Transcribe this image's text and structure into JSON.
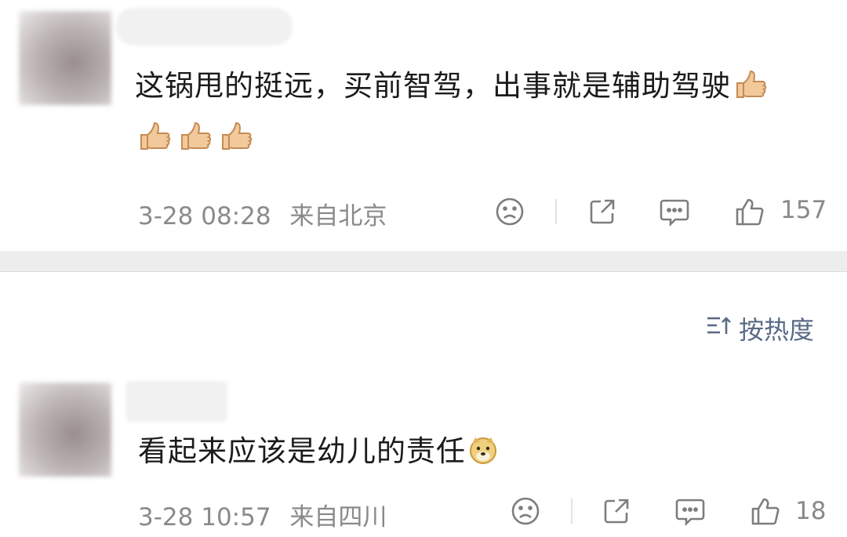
{
  "comments": [
    {
      "text": "这锅甩的挺远，买前智驾，出事就是辅助驾驶",
      "emojis": [
        "thumbs-up",
        "thumbs-up",
        "thumbs-up",
        "thumbs-up"
      ],
      "date": "3-28",
      "time": "08:28",
      "location": "来自北京",
      "likes": "157"
    },
    {
      "text": "看起来应该是幼儿的责任",
      "emojis": [
        "doge"
      ],
      "date": "3-28",
      "time": "10:57",
      "location": "来自四川",
      "likes": "18"
    }
  ],
  "sort": {
    "label": "按热度"
  },
  "colors": {
    "meta_text": "#8a8a8a",
    "sort_text": "#5a6b86",
    "divider_bar": "#ededed"
  }
}
